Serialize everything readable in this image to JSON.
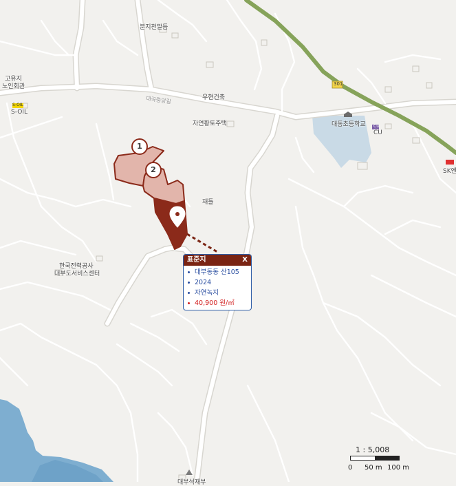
{
  "map": {
    "place_labels": {
      "boonji": "분지천말듬",
      "goyuji": "고유지",
      "noinhoegwan": "노인회관",
      "soil_brand": "S-OIL",
      "soil": "S-OIL",
      "road_name": "대곡중앙길",
      "road_no": "301",
      "woohyun": "우현건축",
      "jayeon": "자연황토주택",
      "school": "대동초등학교",
      "cu_brand": "CU",
      "cu": "CU",
      "sk": "SK엔",
      "jaetul": "재틀",
      "kepco": "한국전력공사",
      "kepco2": "대부도서비스센터",
      "bottom_place": "대부석재부"
    },
    "parcel_numbers": [
      "1",
      "2"
    ],
    "colors": {
      "parcel_fill": "#8b2a1a",
      "parcel_light": "#e2b5ab",
      "highway": "#86a35a",
      "water": "#7eaed0",
      "school_area": "#c9dae6"
    }
  },
  "popup": {
    "title": "표준지",
    "close_label": "X",
    "items": [
      "대부동동 산105",
      "2024",
      "자연녹지",
      "40,900 원/㎡"
    ]
  },
  "scale": {
    "ratio": "1 : 5,008",
    "tick_0": "0",
    "tick_50": "50 m",
    "tick_100": "100 m"
  }
}
